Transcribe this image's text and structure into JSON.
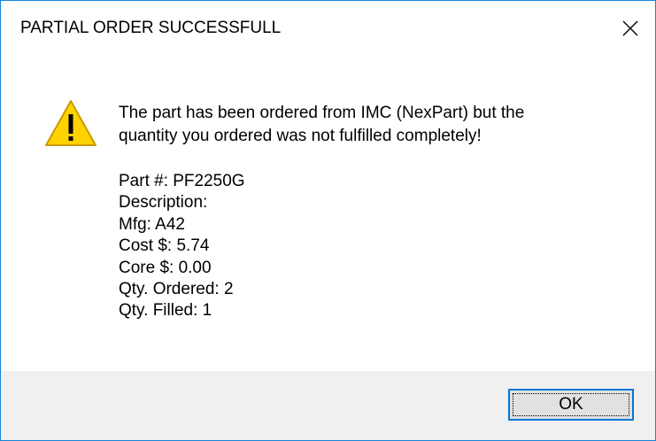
{
  "dialog": {
    "title": "PARTIAL ORDER SUCCESSFULL",
    "close_icon": "close-icon",
    "warning_icon": "warning-icon",
    "message_line1": "The part has been ordered from IMC (NexPart) but the",
    "message_line2": "quantity you ordered was not fulfilled completely!",
    "details": {
      "part": "Part #: PF2250G",
      "description": "Description:",
      "mfg": "Mfg: A42",
      "cost": "Cost $: 5.74",
      "core": "Core $: 0.00",
      "qty_ordered": "Qty. Ordered: 2",
      "qty_filled": "Qty. Filled: 1"
    },
    "ok_label": "OK"
  },
  "colors": {
    "border": "#1883d7",
    "footer_bg": "#f0f0f0",
    "button_bg": "#e1e1e1",
    "button_focus_border": "#0078d7",
    "warning_fill": "#ffd200",
    "warning_outline": "#c89b00"
  }
}
